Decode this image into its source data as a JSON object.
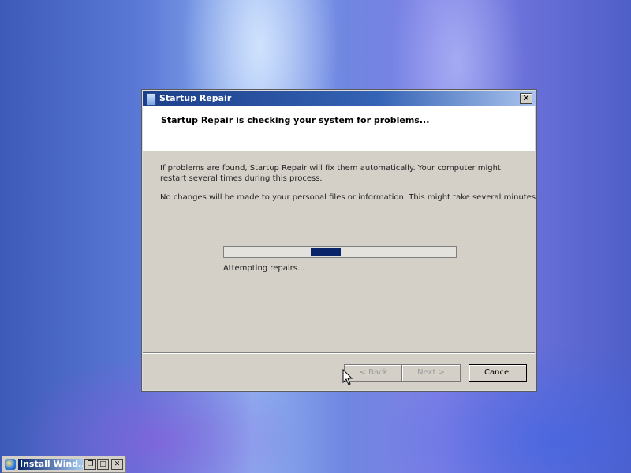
{
  "window": {
    "title": "Startup Repair",
    "close_glyph": "✕"
  },
  "header": {
    "heading": "Startup Repair is checking your system for problems..."
  },
  "content": {
    "paragraph1": "If problems are found, Startup Repair will fix them automatically. Your computer might restart several times during this process.",
    "paragraph2": "No changes will be made to your personal files or information. This might take several minutes.",
    "progress_style": "marquee (indeterminate)",
    "status": "Attempting repairs..."
  },
  "buttons": {
    "back_label": "< Back",
    "next_label": "Next >",
    "cancel_label": "Cancel"
  },
  "taskbar": {
    "item_title": "Install Wind...",
    "restore_glyph": "❐",
    "maximize_glyph": "□",
    "close_glyph": "✕"
  },
  "colors": {
    "title_bar": "#1d3f89",
    "progress_fill": "#0a246a",
    "dialog_bg": "#d4d0c8"
  }
}
